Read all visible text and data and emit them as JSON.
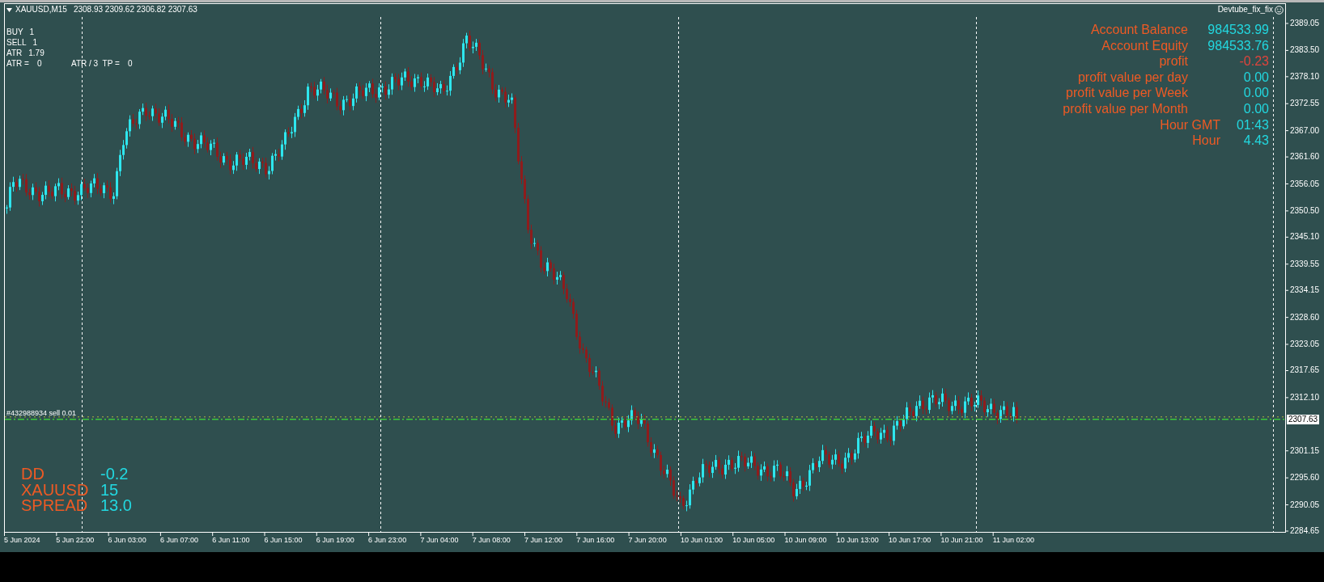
{
  "chart": {
    "symbol": "XAUUSD,M15",
    "ohlc": "2308.93 2309.62 2306.82 2307.63",
    "indicators": [
      {
        "label": "BUY",
        "value": "1"
      },
      {
        "label": "SELL",
        "value": "1"
      },
      {
        "label": "ATR",
        "value": "1.79"
      }
    ],
    "atr_row": [
      {
        "label": "ATR =",
        "value": "0"
      },
      {
        "label": "ATR / 3  TP =",
        "value": "0"
      }
    ],
    "expert_name": "Devtube_fix_fix",
    "account_panel": [
      {
        "label": "Account Balance",
        "value": "984533.99",
        "color": "#22d8e0"
      },
      {
        "label": "Account Equity",
        "value": "984533.76",
        "color": "#22d8e0"
      },
      {
        "label": "profit",
        "value": "-0.23",
        "color": "#e0443c"
      },
      {
        "label": "profit value per day",
        "value": "0.00",
        "color": "#22d8e0"
      },
      {
        "label": "profit value per Week",
        "value": "0.00",
        "color": "#22d8e0"
      },
      {
        "label": "profit value per Month",
        "value": "0.00",
        "color": "#22d8e0"
      }
    ],
    "time_panel": [
      {
        "label": "Hour GMT",
        "value": "01:43"
      },
      {
        "label": "Hour",
        "value": "4.43"
      }
    ],
    "order_label": "#432988934 sell 0.01",
    "stats": [
      {
        "label": "DD",
        "value": "-0.2"
      },
      {
        "label": "XAUUSD",
        "value": "15"
      },
      {
        "label": "SPREAD",
        "value": "13.0"
      }
    ],
    "price_axis": [
      "2389.05",
      "2383.50",
      "2378.10",
      "2372.55",
      "2367.00",
      "2361.60",
      "2356.05",
      "2350.50",
      "2345.10",
      "2339.55",
      "2334.15",
      "2328.60",
      "2323.05",
      "2317.65",
      "2312.10",
      "2301.15",
      "2295.60",
      "2290.05",
      "2284.65"
    ],
    "current_price": "2307.63",
    "time_axis": [
      "5 Jun 2024",
      "5 Jun 22:00",
      "6 Jun 03:00",
      "6 Jun 07:00",
      "6 Jun 11:00",
      "6 Jun 15:00",
      "6 Jun 19:00",
      "6 Jun 23:00",
      "7 Jun 04:00",
      "7 Jun 08:00",
      "7 Jun 12:00",
      "7 Jun 16:00",
      "7 Jun 20:00",
      "10 Jun 01:00",
      "10 Jun 05:00",
      "10 Jun 09:00",
      "10 Jun 13:00",
      "10 Jun 17:00",
      "10 Jun 21:00",
      "11 Jun 02:00"
    ]
  }
}
